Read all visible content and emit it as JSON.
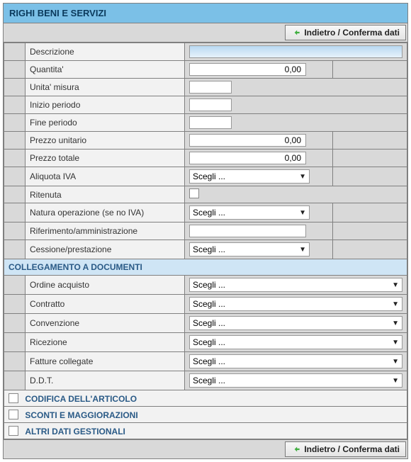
{
  "title": "RIGHI BENI E SERVIZI",
  "buttons": {
    "back_confirm": "Indietro / Conferma dati"
  },
  "fields": {
    "descrizione": {
      "label": "Descrizione",
      "value": ""
    },
    "quantita": {
      "label": "Quantita'",
      "value": "0,00"
    },
    "unita_misura": {
      "label": "Unita' misura",
      "value": ""
    },
    "inizio_periodo": {
      "label": "Inizio periodo",
      "value": ""
    },
    "fine_periodo": {
      "label": "Fine periodo",
      "value": ""
    },
    "prezzo_unitario": {
      "label": "Prezzo unitario",
      "value": "0,00"
    },
    "prezzo_totale": {
      "label": "Prezzo totale",
      "value": "0,00"
    },
    "aliquota_iva": {
      "label": "Aliquota IVA",
      "selected": "Scegli ..."
    },
    "ritenuta": {
      "label": "Ritenuta",
      "checked": false
    },
    "natura_op": {
      "label": "Natura operazione (se no IVA)",
      "selected": "Scegli ..."
    },
    "riferimento_amm": {
      "label": "Riferimento/amministrazione",
      "value": ""
    },
    "cessione_prest": {
      "label": "Cessione/prestazione",
      "selected": "Scegli ..."
    }
  },
  "sections": {
    "collegamento_titolo": "COLLEGAMENTO A DOCUMENTI",
    "ordine_acquisto": {
      "label": "Ordine acquisto",
      "selected": "Scegli ..."
    },
    "contratto": {
      "label": "Contratto",
      "selected": "Scegli ..."
    },
    "convenzione": {
      "label": "Convenzione",
      "selected": "Scegli ..."
    },
    "ricezione": {
      "label": "Ricezione",
      "selected": "Scegli ..."
    },
    "fatture_collegate": {
      "label": "Fatture collegate",
      "selected": "Scegli ..."
    },
    "ddt": {
      "label": "D.D.T.",
      "selected": "Scegli ..."
    }
  },
  "collapsibles": {
    "codifica_articolo": "CODIFICA DELL'ARTICOLO",
    "sconti_maggiorazioni": "SCONTI E MAGGIORAZIONI",
    "altri_dati_gestionali": "ALTRI DATI GESTIONALI"
  }
}
